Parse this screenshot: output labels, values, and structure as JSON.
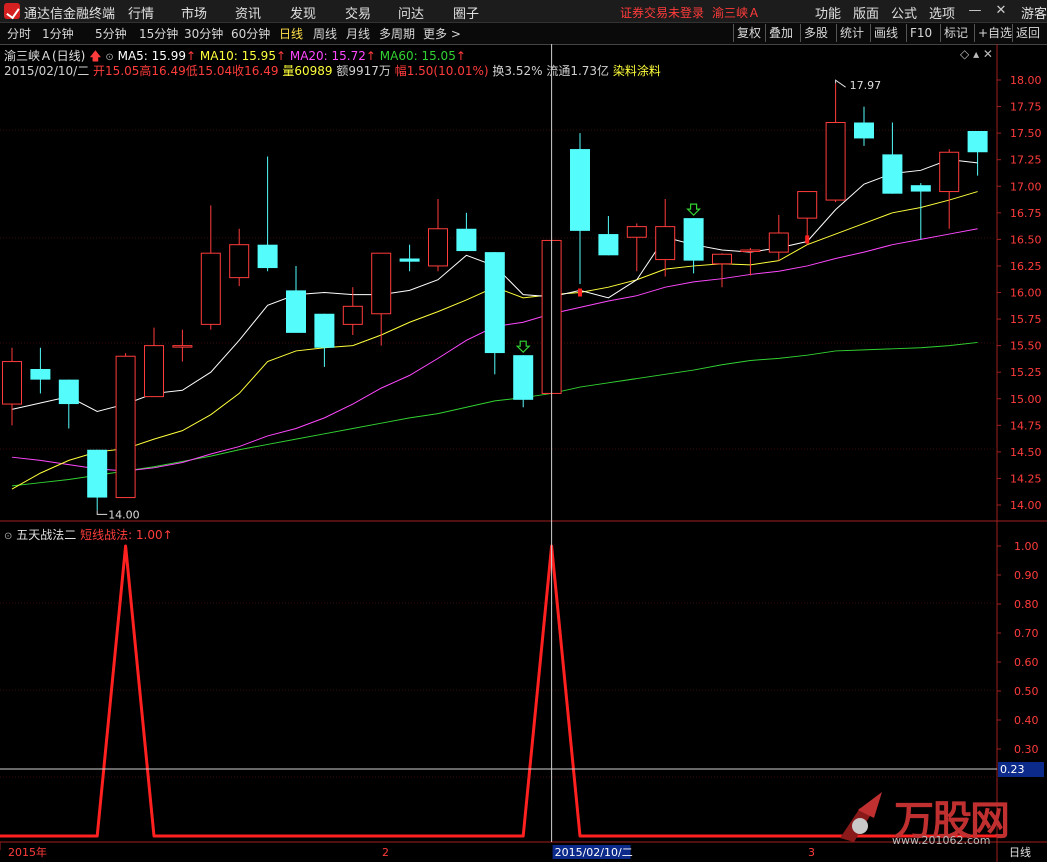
{
  "app": {
    "title": "通达信金融终端"
  },
  "menu": [
    "行情",
    "市场",
    "资讯",
    "发现",
    "交易",
    "问达",
    "圈子"
  ],
  "status": {
    "login_warning": "证券交易未登录",
    "stock_name": "渝三峡Ａ"
  },
  "right_menu": [
    "功能",
    "版面",
    "公式",
    "选项"
  ],
  "guest_label": "游客",
  "periods": [
    "分时",
    "1分钟",
    "5分钟",
    "15分钟",
    "30分钟",
    "60分钟",
    "日线",
    "周线",
    "月线",
    "多周期",
    "更多 >"
  ],
  "active_period": "日线",
  "right_buttons": [
    "复权",
    "叠加",
    "多股",
    "统计",
    "画线",
    "F10",
    "标记",
    "+自选",
    "返回"
  ],
  "main_chart": {
    "stock_label": "渝三峡Ａ(日线)",
    "ma5": "MA5: 15.99",
    "ma10": "MA10: 15.95",
    "ma20": "MA20: 15.72",
    "ma60": "MA60: 15.05",
    "info": {
      "date": "2015/02/10/二",
      "open": "开15.05",
      "high": "高16.49",
      "low": "低15.04",
      "close": "收16.49",
      "volume": "量60989",
      "amount": "额9917万",
      "change": "幅1.50(10.01%)",
      "turnover": "换3.52%",
      "float": "流通1.73亿",
      "sector": "染料涂料"
    },
    "y_ticks": [
      "18.00",
      "17.75",
      "17.50",
      "17.25",
      "17.00",
      "16.75",
      "16.50",
      "16.25",
      "16.00",
      "15.75",
      "15.50",
      "15.25",
      "15.00",
      "14.75",
      "14.50",
      "14.25",
      "14.00"
    ],
    "min_label": "14.00",
    "max_label": "17.97"
  },
  "indicator": {
    "name": "五天战法二",
    "line_label": "短线战法: 1.00",
    "y_ticks": [
      "1.00",
      "0.90",
      "0.80",
      "0.70",
      "0.60",
      "0.50",
      "0.40",
      "0.30"
    ],
    "cursor_value": "0.23"
  },
  "x_axis": {
    "labels": [
      "2015年",
      "2",
      "2015/02/10/二",
      "3"
    ],
    "mode": "日线"
  },
  "colors": {
    "up": "#ff3c3c",
    "down": "#54fcfc",
    "ma5": "#ffffff",
    "ma10": "#ffff3c",
    "ma20": "#ff48ff",
    "ma60": "#32d232",
    "signal": "#ff2020"
  },
  "chart_data": {
    "type": "candlestick",
    "ylim": [
      13.85,
      18.15
    ],
    "candles": [
      {
        "o": 14.95,
        "h": 15.48,
        "l": 14.75,
        "c": 15.35
      },
      {
        "o": 15.28,
        "h": 15.48,
        "l": 15.05,
        "c": 15.18
      },
      {
        "o": 15.18,
        "h": 15.18,
        "l": 14.72,
        "c": 14.95
      },
      {
        "o": 14.52,
        "h": 14.52,
        "l": 13.95,
        "c": 14.07
      },
      {
        "o": 14.07,
        "h": 15.43,
        "l": 14.07,
        "c": 15.4
      },
      {
        "o": 15.02,
        "h": 15.67,
        "l": 15.02,
        "c": 15.5
      },
      {
        "o": 15.49,
        "h": 15.65,
        "l": 15.35,
        "c": 15.5
      },
      {
        "o": 15.7,
        "h": 16.82,
        "l": 15.65,
        "c": 16.37
      },
      {
        "o": 16.14,
        "h": 16.6,
        "l": 16.06,
        "c": 16.45
      },
      {
        "o": 16.45,
        "h": 17.28,
        "l": 16.2,
        "c": 16.23
      },
      {
        "o": 16.02,
        "h": 16.25,
        "l": 15.65,
        "c": 15.62
      },
      {
        "o": 15.8,
        "h": 15.8,
        "l": 15.3,
        "c": 15.48
      },
      {
        "o": 15.7,
        "h": 16.05,
        "l": 15.6,
        "c": 15.87
      },
      {
        "o": 15.8,
        "h": 16.35,
        "l": 15.5,
        "c": 16.37
      },
      {
        "o": 16.32,
        "h": 16.45,
        "l": 16.2,
        "c": 16.29
      },
      {
        "o": 16.25,
        "h": 16.88,
        "l": 16.2,
        "c": 16.6
      },
      {
        "o": 16.6,
        "h": 16.75,
        "l": 16.39,
        "c": 16.39
      },
      {
        "o": 16.38,
        "h": 16.38,
        "l": 15.23,
        "c": 15.43
      },
      {
        "o": 15.41,
        "h": 15.41,
        "l": 14.92,
        "c": 14.99
      },
      {
        "o": 15.05,
        "h": 16.49,
        "l": 15.04,
        "c": 16.49
      },
      {
        "o": 17.35,
        "h": 17.5,
        "l": 16.08,
        "c": 16.58
      },
      {
        "o": 16.55,
        "h": 16.72,
        "l": 16.35,
        "c": 16.35
      },
      {
        "o": 16.52,
        "h": 16.65,
        "l": 16.2,
        "c": 16.62
      },
      {
        "o": 16.31,
        "h": 16.88,
        "l": 16.15,
        "c": 16.62
      },
      {
        "o": 16.7,
        "h": 16.7,
        "l": 16.18,
        "c": 16.3
      },
      {
        "o": 16.27,
        "h": 16.37,
        "l": 16.05,
        "c": 16.36
      },
      {
        "o": 16.4,
        "h": 16.42,
        "l": 16.16,
        "c": 16.4
      },
      {
        "o": 16.38,
        "h": 16.73,
        "l": 16.3,
        "c": 16.56
      },
      {
        "o": 16.7,
        "h": 16.95,
        "l": 16.45,
        "c": 16.95
      },
      {
        "o": 16.87,
        "h": 17.97,
        "l": 16.85,
        "c": 17.6
      },
      {
        "o": 17.6,
        "h": 17.75,
        "l": 17.38,
        "c": 17.45
      },
      {
        "o": 17.3,
        "h": 17.6,
        "l": 16.93,
        "c": 16.93
      },
      {
        "o": 17.01,
        "h": 17.03,
        "l": 16.5,
        "c": 16.95
      },
      {
        "o": 16.95,
        "h": 17.35,
        "l": 16.6,
        "c": 17.32
      },
      {
        "o": 17.52,
        "h": 17.52,
        "l": 17.1,
        "c": 17.32
      }
    ],
    "ma5": [
      14.9,
      14.96,
      15.02,
      14.88,
      14.95,
      15.05,
      15.08,
      15.25,
      15.55,
      15.88,
      15.98,
      16.0,
      15.98,
      15.98,
      16.02,
      16.12,
      16.35,
      16.25,
      15.98,
      15.96,
      16.02,
      15.95,
      16.12,
      16.52,
      16.45,
      16.4,
      16.38,
      16.42,
      16.48,
      16.78,
      17.02,
      17.12,
      17.15,
      17.25,
      17.22
    ],
    "ma10": [
      14.15,
      14.3,
      14.42,
      14.5,
      14.53,
      14.62,
      14.7,
      14.85,
      15.05,
      15.35,
      15.45,
      15.48,
      15.5,
      15.6,
      15.72,
      15.82,
      15.93,
      16.05,
      15.95,
      15.98,
      16.0,
      16.05,
      16.12,
      16.22,
      16.25,
      16.27,
      16.26,
      16.3,
      16.45,
      16.55,
      16.65,
      16.75,
      16.8,
      16.87,
      16.95
    ],
    "ma20": [
      14.45,
      14.42,
      14.38,
      14.34,
      14.32,
      14.35,
      14.4,
      14.48,
      14.55,
      14.65,
      14.72,
      14.82,
      14.95,
      15.1,
      15.22,
      15.38,
      15.55,
      15.68,
      15.72,
      15.8,
      15.86,
      15.92,
      15.97,
      16.05,
      16.1,
      16.13,
      16.17,
      16.2,
      16.25,
      16.32,
      16.38,
      16.45,
      16.5,
      16.55,
      16.6
    ],
    "ma60": [
      14.18,
      14.21,
      14.24,
      14.28,
      14.32,
      14.36,
      14.41,
      14.46,
      14.52,
      14.57,
      14.62,
      14.67,
      14.72,
      14.77,
      14.82,
      14.86,
      14.92,
      14.98,
      15.01,
      15.05,
      15.11,
      15.15,
      15.19,
      15.23,
      15.27,
      15.32,
      15.36,
      15.38,
      15.41,
      15.45,
      15.46,
      15.47,
      15.48,
      15.5,
      15.53
    ],
    "signal": [
      0,
      0,
      0,
      0,
      1,
      0,
      0,
      0,
      0,
      0,
      0,
      0,
      0,
      0,
      0,
      0,
      0,
      0,
      0,
      1,
      0,
      0,
      0,
      0,
      0,
      0,
      0,
      0,
      0,
      0,
      0,
      0,
      0,
      0,
      0
    ],
    "cursor_index": 19
  },
  "watermark": {
    "brand": "万股网",
    "url": "www.201062.com"
  }
}
